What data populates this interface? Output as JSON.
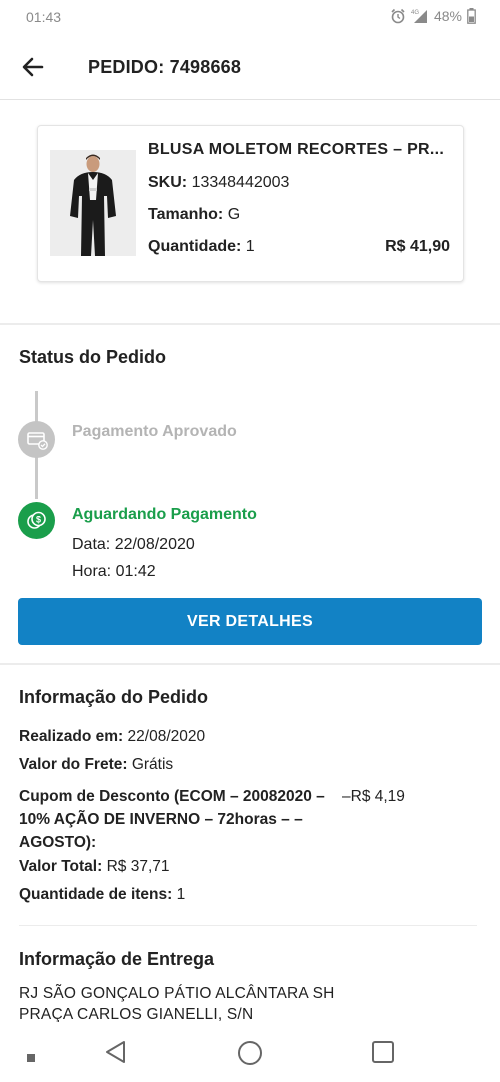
{
  "status_bar": {
    "time": "01:43",
    "battery": "48%",
    "network": "4G"
  },
  "header": {
    "title": "PEDIDO: 7498668"
  },
  "product": {
    "name": "BLUSA MOLETOM RECORTES – PR...",
    "sku_label": "SKU:",
    "sku": "13348442003",
    "size_label": "Tamanho:",
    "size": "G",
    "qty_label": "Quantidade:",
    "qty": "1",
    "price": "R$ 41,90"
  },
  "order_status": {
    "title": "Status do Pedido",
    "steps": [
      {
        "label": "Pagamento Aprovado",
        "state": "inactive",
        "icon": "credit-card-check-icon"
      },
      {
        "label": "Aguardando Pagamento",
        "state": "active",
        "icon": "money-icon",
        "date": "Data: 22/08/2020",
        "time": "Hora: 01:42"
      }
    ],
    "details_button": "VER DETALHES"
  },
  "order_info": {
    "title": "Informação do Pedido",
    "placed_label": "Realizado em:",
    "placed_value": "22/08/2020",
    "shipping_label": "Valor do Frete:",
    "shipping_value": "Grátis",
    "coupon_label": "Cupom de Desconto (ECOM – 20082020 – 10% AÇÃO DE INVERNO – 72horas –  – AGOSTO):",
    "coupon_value": "–R$ 4,19",
    "total_label": "Valor Total:",
    "total_value": "R$ 37,71",
    "items_label": "Quantidade de itens:",
    "items_value": "1"
  },
  "delivery_info": {
    "title": "Informação de Entrega",
    "address_line1": "RJ SÃO GONÇALO PÁTIO ALCÂNTARA SH",
    "address_line2": "PRAÇA CARLOS GIANELLI, S/N"
  },
  "colors": {
    "primary": "#1282c5",
    "success": "#1a9e4b",
    "inactive": "#c4c4c4"
  }
}
